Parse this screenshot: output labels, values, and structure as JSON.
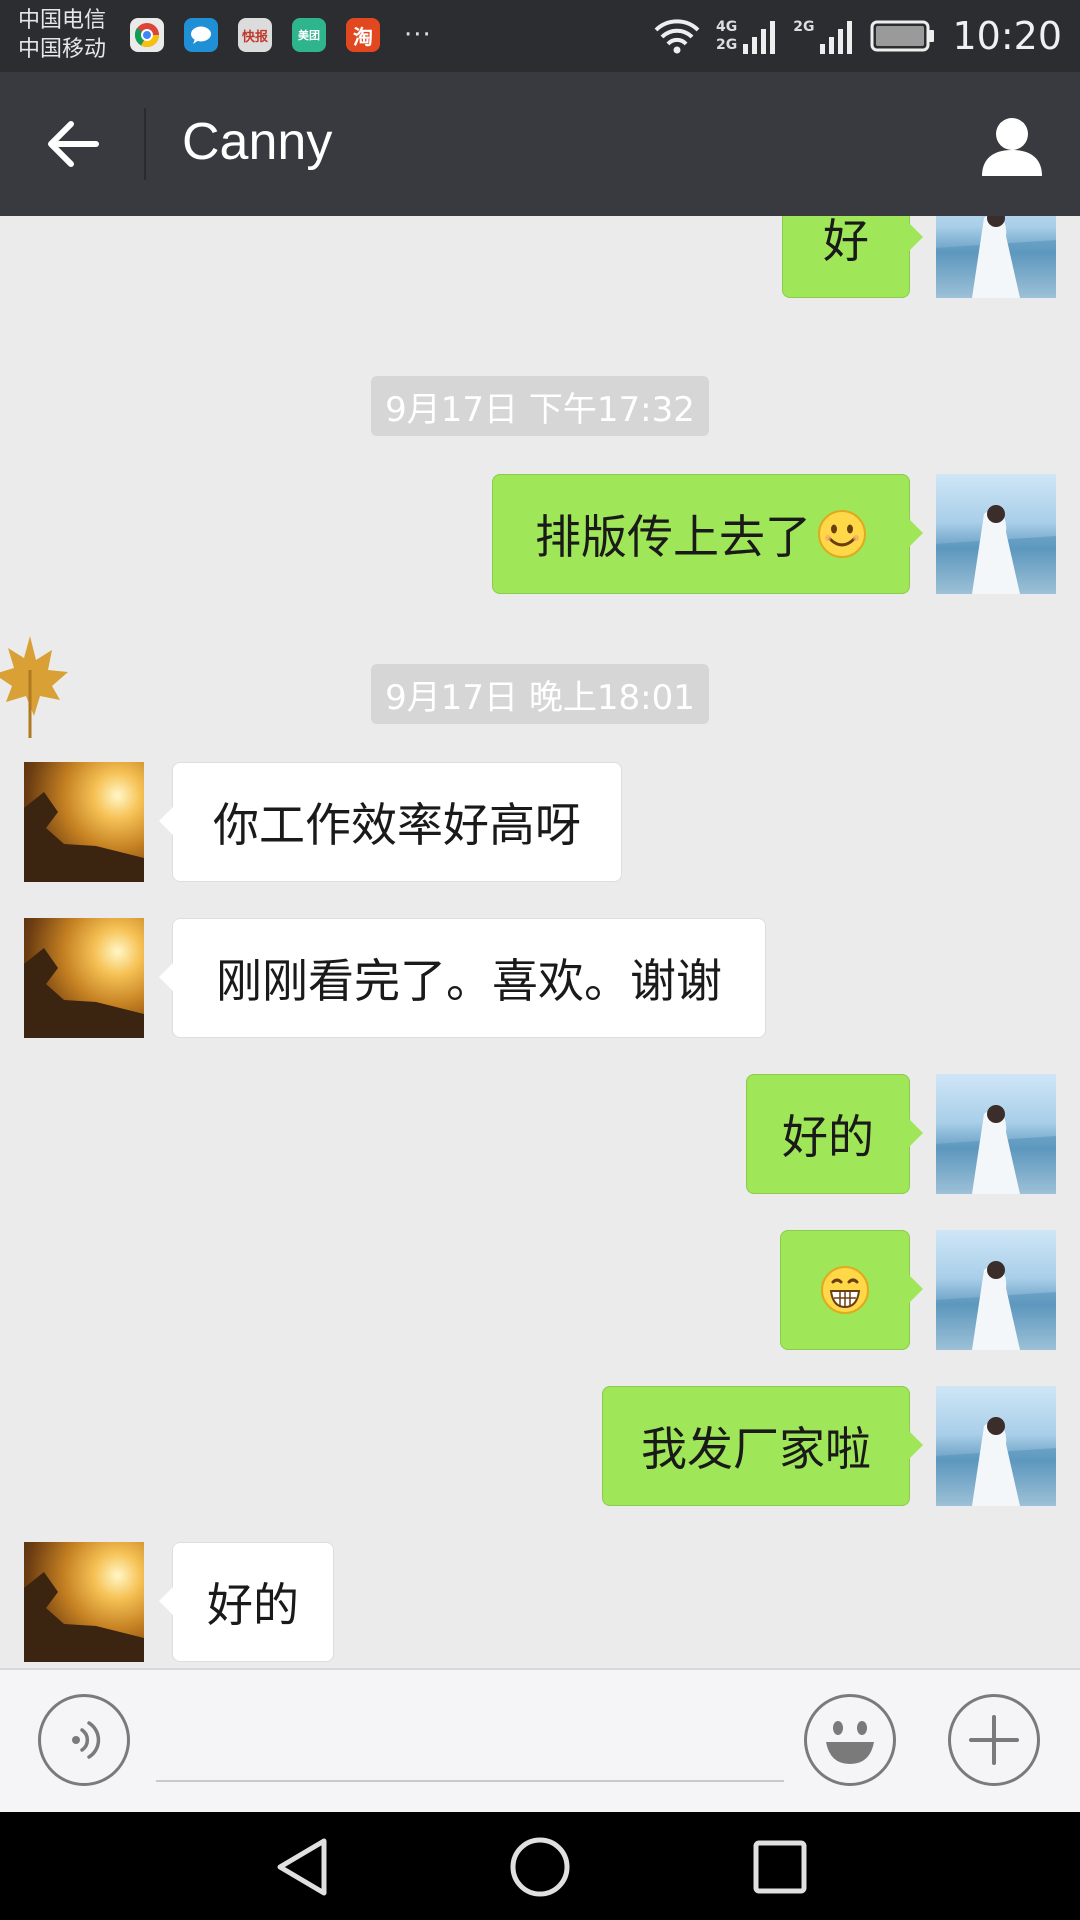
{
  "status_bar": {
    "carrier_1": "中国电信",
    "carrier_2": "中国移动",
    "apps": [
      {
        "name": "chrome-icon",
        "label": "",
        "color": "#e9e9e9"
      },
      {
        "name": "chat-icon",
        "label": "",
        "color": "#1f8fd6"
      },
      {
        "name": "news-icon",
        "label": "快报",
        "color": "#d9d9d9"
      },
      {
        "name": "meituan-icon",
        "label": "美团",
        "color": "#2fb58d"
      },
      {
        "name": "taobao-icon",
        "label": "淘",
        "color": "#e2481f"
      }
    ],
    "more": "···",
    "net_top": "4G",
    "net_bottom": "2G",
    "net_top_2": "2G",
    "time": "10:20"
  },
  "header": {
    "title": "Canny"
  },
  "messages": [
    {
      "type": "msg",
      "side": "right",
      "text": "好"
    },
    {
      "type": "time",
      "text": "9月17日 下午17:32"
    },
    {
      "type": "msg",
      "side": "right",
      "text": "排版传上去了",
      "emoji": "smile-emoji"
    },
    {
      "type": "time",
      "text": "9月17日 晚上18:01"
    },
    {
      "type": "msg",
      "side": "left",
      "text": "你工作效率好高呀"
    },
    {
      "type": "msg",
      "side": "left",
      "text": "刚刚看完了。喜欢。谢谢"
    },
    {
      "type": "msg",
      "side": "right",
      "text": "好的"
    },
    {
      "type": "msg",
      "side": "right",
      "text": "",
      "emoji": "grin-emoji"
    },
    {
      "type": "msg",
      "side": "right",
      "text": "我发厂家啦"
    },
    {
      "type": "msg",
      "side": "left",
      "text": "好的"
    }
  ],
  "input_bar": {
    "placeholder": ""
  },
  "colors": {
    "bubble_self": "#9fe658",
    "bubble_other": "#ffffff",
    "header_bg": "#393a3f",
    "chat_bg": "#ebebeb"
  }
}
